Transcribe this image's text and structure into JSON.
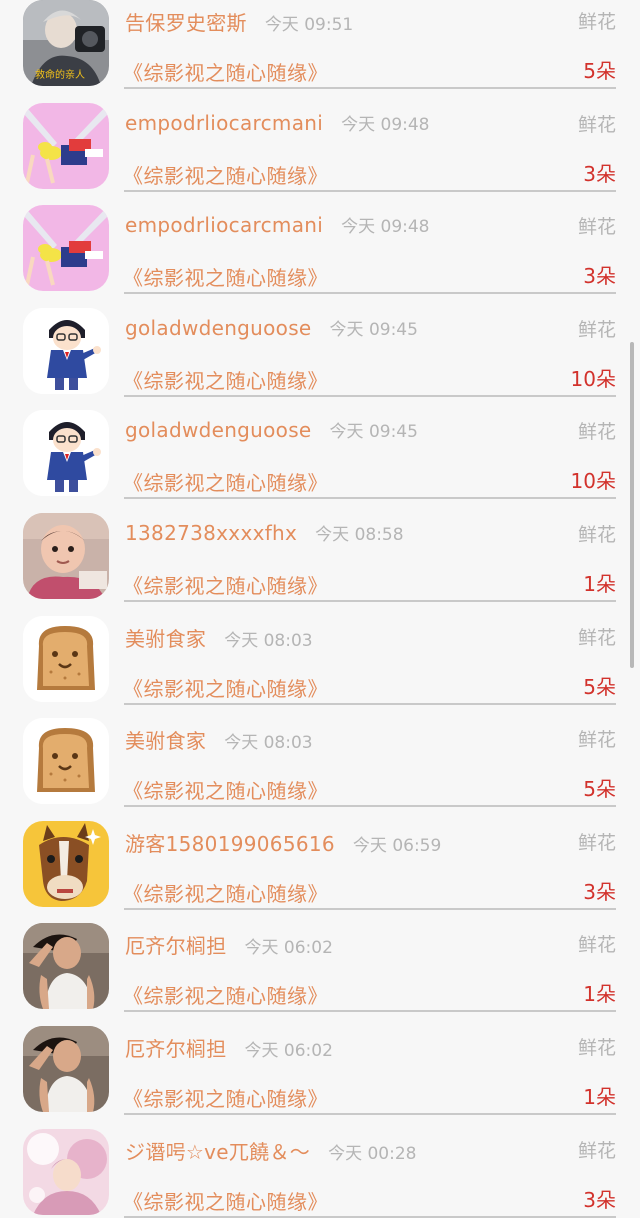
{
  "messages": [
    {
      "avatar": "photo-group",
      "name": "告保罗史密斯",
      "time": "今天 09:51",
      "gift": "鲜花",
      "book": "《综影视之随心随缘》",
      "count": "5朵"
    },
    {
      "avatar": "cartoon-girl",
      "name": "empodrliocarcmani",
      "time": "今天 09:48",
      "gift": "鲜花",
      "book": "《综影视之随心随缘》",
      "count": "3朵"
    },
    {
      "avatar": "cartoon-girl",
      "name": "empodrliocarcmani",
      "time": "今天 09:48",
      "gift": "鲜花",
      "book": "《综影视之随心随缘》",
      "count": "3朵"
    },
    {
      "avatar": "cartoon-boy",
      "name": "goladwdenguoose",
      "time": "今天 09:45",
      "gift": "鲜花",
      "book": "《综影视之随心随缘》",
      "count": "10朵"
    },
    {
      "avatar": "cartoon-boy",
      "name": "goladwdenguoose",
      "time": "今天 09:45",
      "gift": "鲜花",
      "book": "《综影视之随心随缘》",
      "count": "10朵"
    },
    {
      "avatar": "baby-photo",
      "name": "1382738xxxxfhx",
      "time": "今天 08:58",
      "gift": "鲜花",
      "book": "《综影视之随心随缘》",
      "count": "1朵"
    },
    {
      "avatar": "toast",
      "name": "美驸食家",
      "time": "今天 08:03",
      "gift": "鲜花",
      "book": "《综影视之随心随缘》",
      "count": "5朵"
    },
    {
      "avatar": "toast",
      "name": "美驸食家",
      "time": "今天 08:03",
      "gift": "鲜花",
      "book": "《综影视之随心随缘》",
      "count": "5朵"
    },
    {
      "avatar": "horse",
      "name": "游客1580199065616",
      "time": "今天 06:59",
      "gift": "鲜花",
      "book": "《综影视之随心随缘》",
      "count": "3朵"
    },
    {
      "avatar": "man-photo",
      "name": "厄齐尔榈担",
      "time": "今天 06:02",
      "gift": "鲜花",
      "book": "《综影视之随心随缘》",
      "count": "1朵"
    },
    {
      "avatar": "man-photo",
      "name": "厄齐尔榈担",
      "time": "今天 06:02",
      "gift": "鲜花",
      "book": "《综影视之随心随缘》",
      "count": "1朵"
    },
    {
      "avatar": "pink-photo",
      "name": "ジ谮呺☆ve兀饒＆～",
      "time": "今天 00:28",
      "gift": "鲜花",
      "book": "《综影视之随心随缘》",
      "count": "3朵"
    }
  ]
}
